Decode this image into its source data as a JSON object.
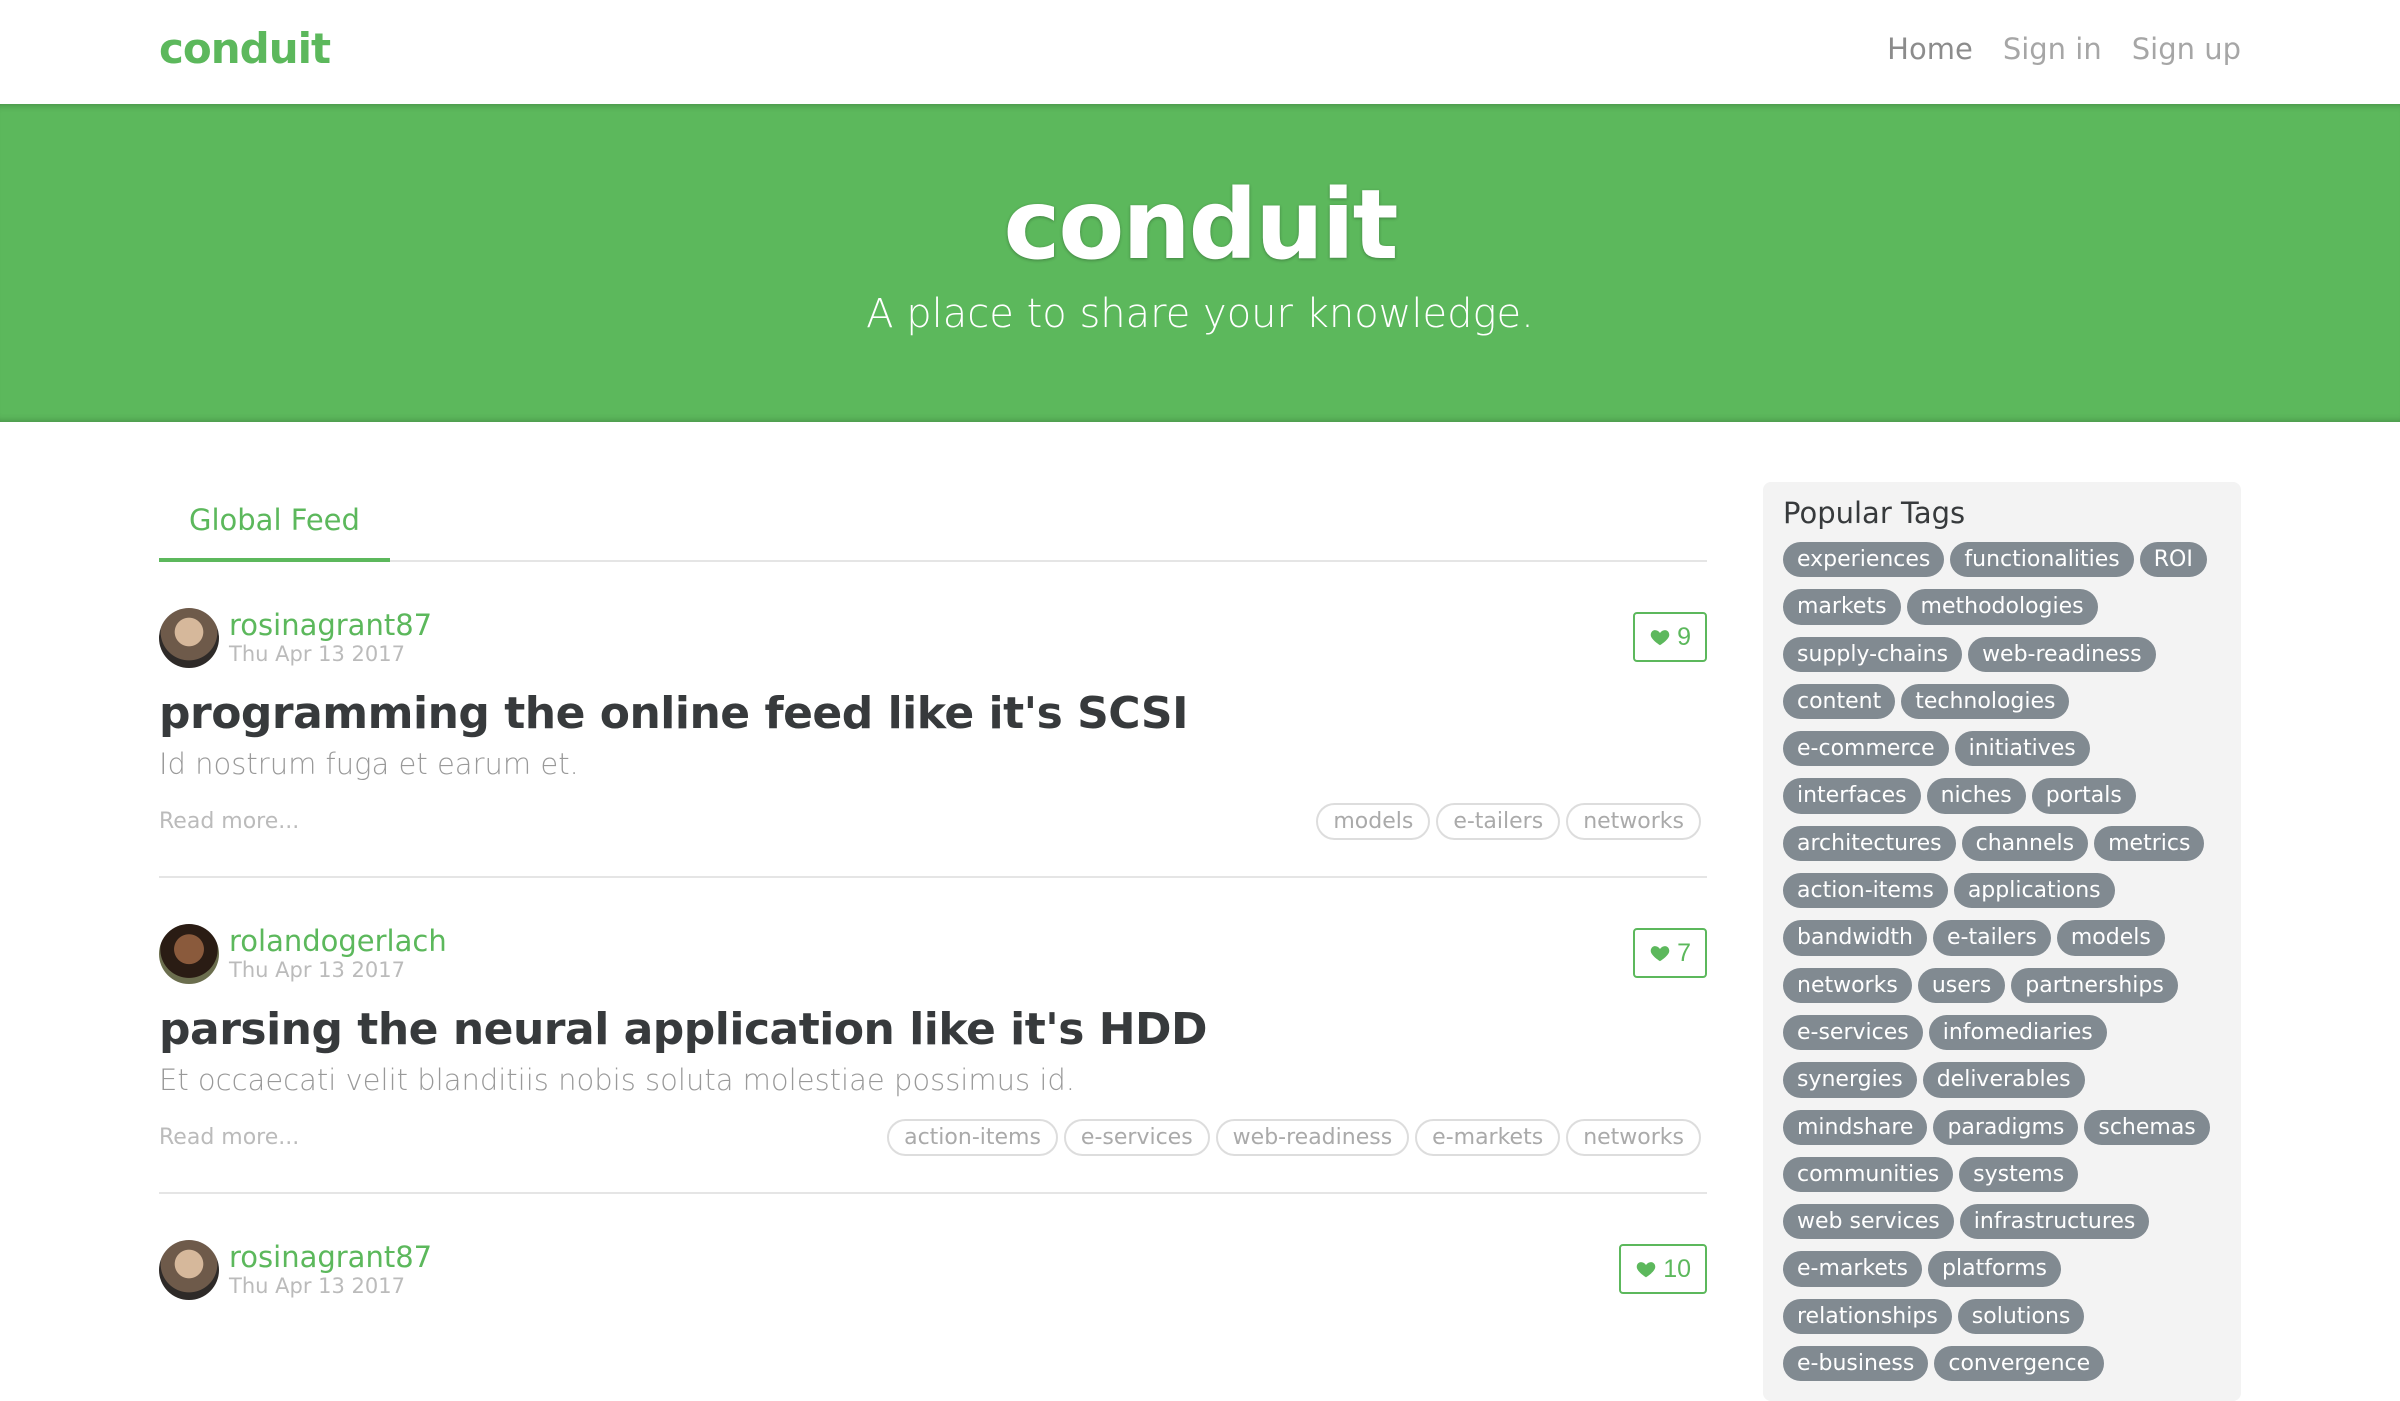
{
  "nav": {
    "brand": "conduit",
    "links": [
      "Home",
      "Sign in",
      "Sign up"
    ]
  },
  "banner": {
    "title": "conduit",
    "subtitle": "A place to share your knowledge."
  },
  "feed": {
    "tabs": [
      "Global Feed"
    ],
    "read_more": "Read more...",
    "articles": [
      {
        "author": "rosinagrant87",
        "date": "Thu Apr 13 2017",
        "likes": "9",
        "title": "programming the online feed like it's SCSI",
        "description": "Id nostrum fuga et earum et.",
        "tags": [
          "models",
          "e-tailers",
          "networks"
        ]
      },
      {
        "author": "rolandogerlach",
        "date": "Thu Apr 13 2017",
        "likes": "7",
        "title": "parsing the neural application like it's HDD",
        "description": "Et occaecati velit blanditiis nobis soluta molestiae possimus id.",
        "tags": [
          "action-items",
          "e-services",
          "web-readiness",
          "e-markets",
          "networks"
        ]
      },
      {
        "author": "rosinagrant87",
        "date": "Thu Apr 13 2017",
        "likes": "10",
        "title": "",
        "description": "",
        "tags": []
      }
    ]
  },
  "sidebar": {
    "heading": "Popular Tags",
    "tags": [
      "experiences",
      "functionalities",
      "ROI",
      "markets",
      "methodologies",
      "supply-chains",
      "web-readiness",
      "content",
      "technologies",
      "e-commerce",
      "initiatives",
      "interfaces",
      "niches",
      "portals",
      "architectures",
      "channels",
      "metrics",
      "action-items",
      "applications",
      "bandwidth",
      "e-tailers",
      "models",
      "networks",
      "users",
      "partnerships",
      "e-services",
      "infomediaries",
      "synergies",
      "deliverables",
      "mindshare",
      "paradigms",
      "schemas",
      "communities",
      "systems",
      "web services",
      "infrastructures",
      "e-markets",
      "platforms",
      "relationships",
      "solutions",
      "e-business",
      "convergence"
    ]
  },
  "colors": {
    "brand": "#5cb85c",
    "tag_bg": "#818a91"
  }
}
